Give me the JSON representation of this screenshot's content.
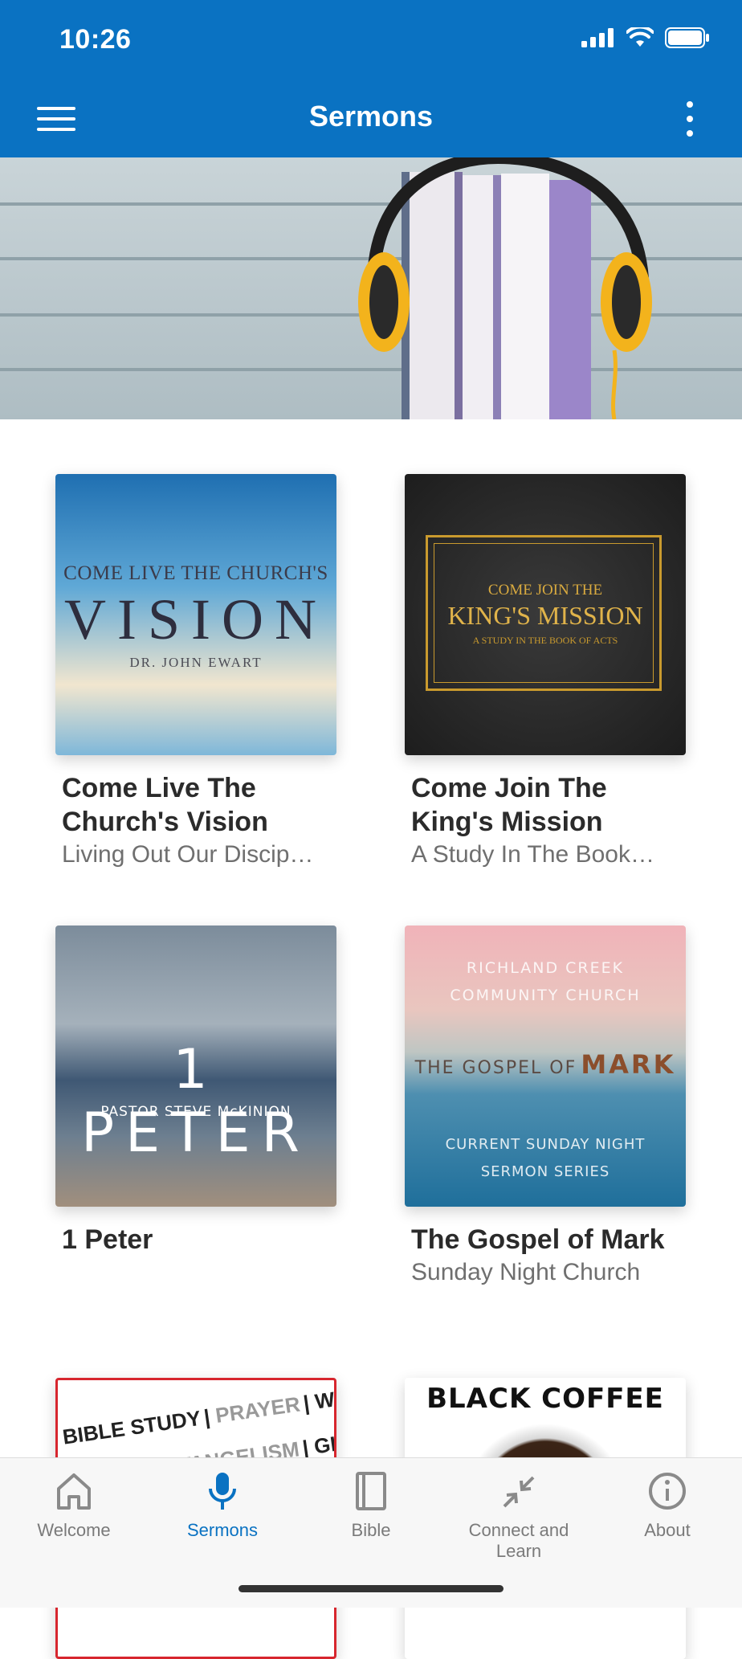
{
  "status": {
    "time": "10:26"
  },
  "header": {
    "title": "Sermons"
  },
  "colors": {
    "brand": "#0a72c2",
    "title_text": "#2b2b2b",
    "subtitle_text": "#6f6f6f",
    "tab_inactive": "#7a7a7a"
  },
  "series": [
    {
      "title": "Come Live The Church's Vision",
      "subtitle": "Living Out Our Discip…",
      "art": {
        "line1": "COME LIVE THE CHURCH'S",
        "line2": "VISION",
        "line3": "DR. JOHN EWART"
      }
    },
    {
      "title": "Come Join The King's Mission",
      "subtitle": "A Study In The Book…",
      "art": {
        "line1": "COME JOIN THE",
        "line2": "KING'S MISSION",
        "line3": "A STUDY IN THE BOOK OF ACTS"
      }
    },
    {
      "title": "1 Peter",
      "subtitle": "",
      "art": {
        "line1": "1 PETER",
        "line2": "PASTOR STEVE McKINION"
      }
    },
    {
      "title": "The Gospel of Mark",
      "subtitle": "Sunday Night Church",
      "art": {
        "line1": "RICHLAND CREEK",
        "line2": "COMMUNITY CHURCH",
        "line3": "THE GOSPEL OF",
        "line4": "MARK",
        "line5": "CURRENT SUNDAY NIGHT",
        "line6": "SERMON SERIES"
      }
    },
    {
      "title": "",
      "subtitle": "",
      "art": {
        "line1": "BIBLE STUDY",
        "line2": "PRAYER",
        "line3": "WORSHIP",
        "line4": "EVANGELISM",
        "line5": "GIVING"
      }
    },
    {
      "title": "",
      "subtitle": "",
      "art": {
        "line1": "BLACK COFFEE"
      }
    }
  ],
  "tabs": [
    {
      "label": "Welcome",
      "icon": "home-icon",
      "active": false
    },
    {
      "label": "Sermons",
      "icon": "microphone-icon",
      "active": true
    },
    {
      "label": "Bible",
      "icon": "book-icon",
      "active": false
    },
    {
      "label": "Connect and Learn",
      "icon": "arrows-in-icon",
      "active": false
    },
    {
      "label": "About",
      "icon": "info-icon",
      "active": false
    }
  ]
}
